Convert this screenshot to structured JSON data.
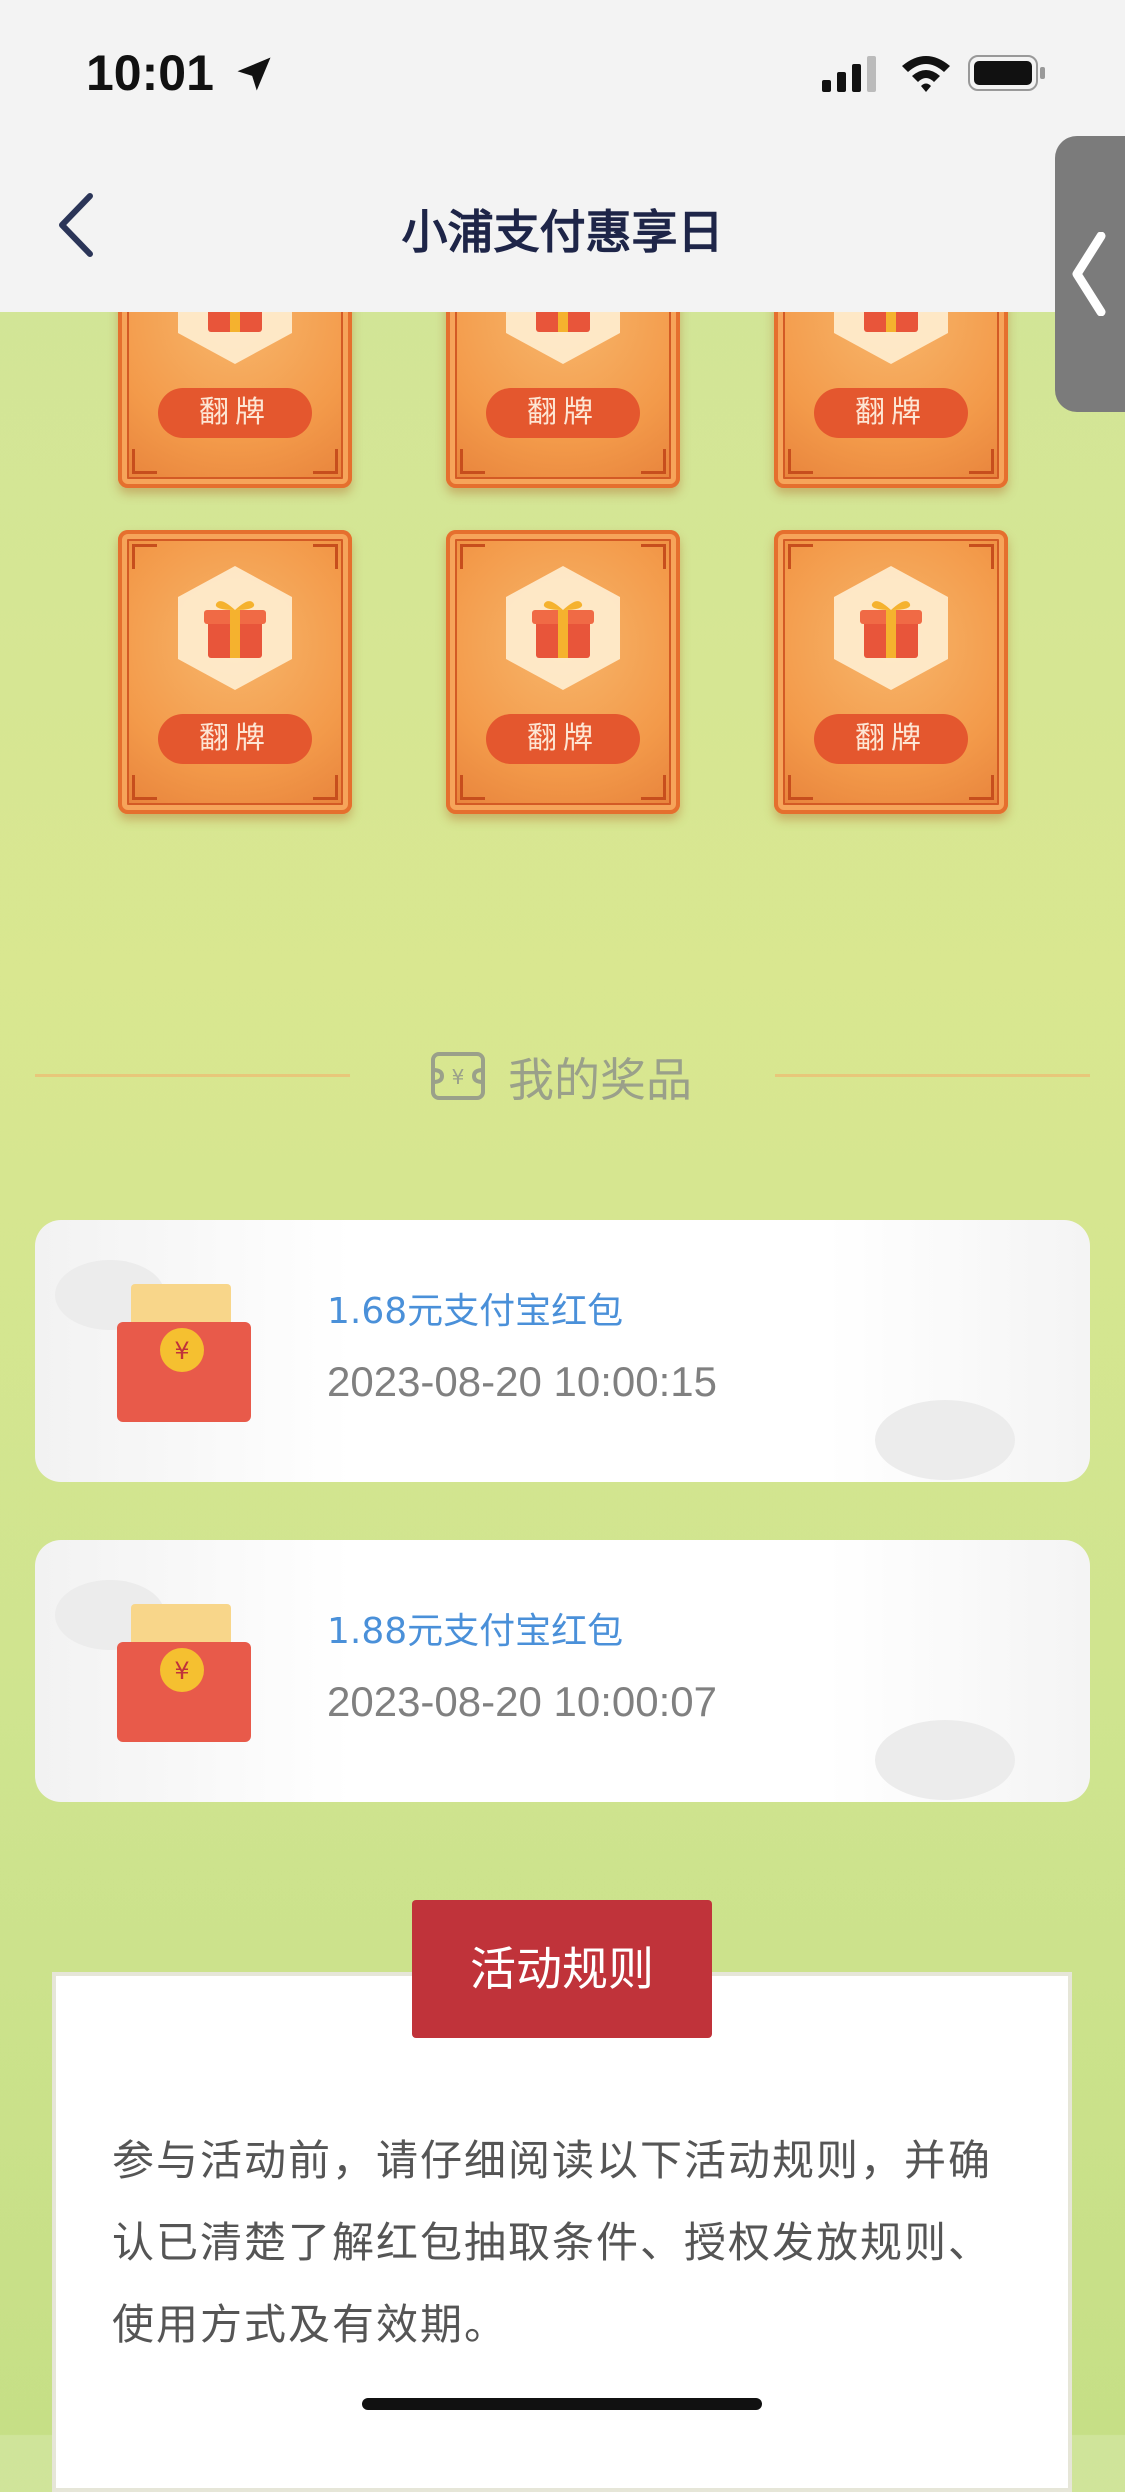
{
  "status_bar": {
    "time": "10:01"
  },
  "nav": {
    "title": "小浦支付惠享日"
  },
  "cards": {
    "flip_label": "翻牌"
  },
  "prizes_section": {
    "title": "我的奖品"
  },
  "prizes": [
    {
      "name": "1.68元支付宝红包",
      "time": "2023-08-20 10:00:15"
    },
    {
      "name": "1.88元支付宝红包",
      "time": "2023-08-20 10:00:07"
    }
  ],
  "rules": {
    "button_label": "活动规则",
    "text": "参与活动前，请仔细阅读以下活动规则，并确认已清楚了解红包抽取条件、授权发放规则、使用方式及有效期。"
  },
  "colors": {
    "accent_red": "#c0333a",
    "prize_blue": "#4a90d9",
    "card_orange": "#f39a4a"
  }
}
